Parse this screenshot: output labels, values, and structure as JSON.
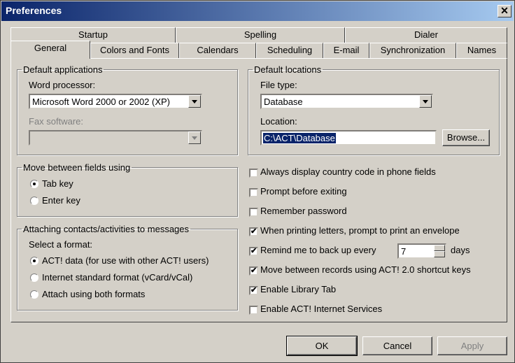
{
  "window": {
    "title": "Preferences",
    "close_glyph": "✕"
  },
  "tabs_back": [
    "Startup",
    "Spelling",
    "Dialer"
  ],
  "tabs_front": [
    "General",
    "Colors and Fonts",
    "Calendars",
    "Scheduling",
    "E-mail",
    "Synchronization",
    "Names"
  ],
  "active_tab": "General",
  "default_apps": {
    "legend": "Default applications",
    "word_label": "Word processor:",
    "word_value": "Microsoft Word 2000 or 2002 (XP)",
    "fax_label": "Fax software:",
    "fax_value": ""
  },
  "move_fields": {
    "legend": "Move between fields using",
    "options": [
      "Tab key",
      "Enter key"
    ],
    "selected": "Tab key"
  },
  "attaching": {
    "legend": "Attaching contacts/activities to messages",
    "prompt": "Select a format:",
    "options": [
      "ACT! data (for use with other ACT! users)",
      "Internet standard format (vCard/vCal)",
      "Attach using both formats"
    ],
    "selected": "ACT! data (for use with other ACT! users)"
  },
  "default_locations": {
    "legend": "Default locations",
    "file_type_label": "File type:",
    "file_type_value": "Database",
    "location_label": "Location:",
    "location_value": "C:\\ACT\\Database",
    "browse_label": "Browse..."
  },
  "checkboxes": [
    {
      "label": "Always display country code in phone fields",
      "checked": false
    },
    {
      "label": "Prompt before exiting",
      "checked": false
    },
    {
      "label": "Remember password",
      "checked": false
    },
    {
      "label": "When printing letters, prompt to print an envelope",
      "checked": true
    },
    {
      "label": "Remind me to back up every",
      "checked": true
    },
    {
      "label": "Move between records using ACT! 2.0 shortcut keys",
      "checked": true
    },
    {
      "label": "Enable Library Tab",
      "checked": true
    },
    {
      "label": "Enable ACT! Internet Services",
      "checked": false
    }
  ],
  "backup_days": {
    "value": "7",
    "unit": "days"
  },
  "buttons": {
    "ok": "OK",
    "cancel": "Cancel",
    "apply": "Apply"
  },
  "colors": {
    "title_start": "#0a246a",
    "title_end": "#a6caf0",
    "face": "#d4d0c8",
    "selection": "#0a246a"
  },
  "icons": {
    "check": "✔",
    "close": "close-icon",
    "dropdown": "chevron-down-icon"
  }
}
